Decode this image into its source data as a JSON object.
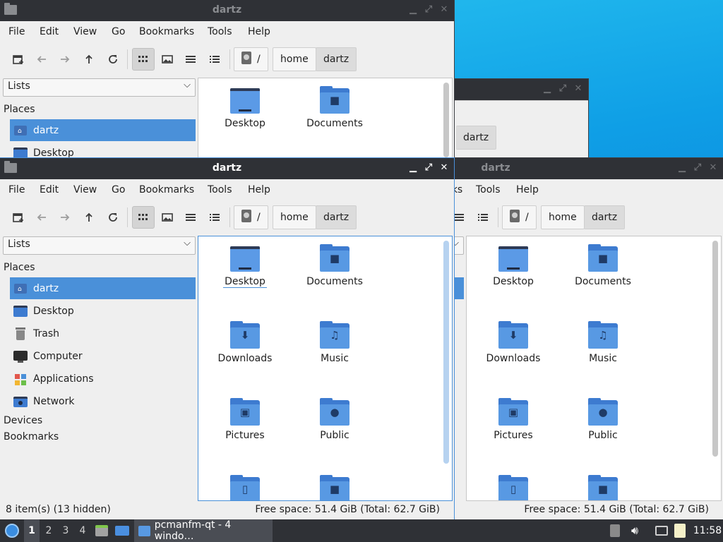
{
  "colors": {
    "accent": "#4a90d9",
    "folder": "#5899e3",
    "titlebar": "#2f3136",
    "window_bg": "#efefef"
  },
  "window": {
    "title": "dartz",
    "menu": [
      "File",
      "Edit",
      "View",
      "Go",
      "Bookmarks",
      "Tools",
      "Help"
    ],
    "toolbar": [
      "new-tab-icon",
      "back-arrow-icon",
      "forward-arrow-icon",
      "up-arrow-icon",
      "reload-icon",
      "icon-view-icon",
      "thumbnail-view-icon",
      "compact-view-icon",
      "detailed-list-icon"
    ],
    "path": {
      "root": "/",
      "segments": [
        "home",
        "dartz"
      ]
    },
    "side_mode": "Lists",
    "places_header": "Places",
    "places": [
      {
        "label": "dartz",
        "icon": "home-folder-icon"
      },
      {
        "label": "Desktop",
        "icon": "desktop-icon"
      },
      {
        "label": "Trash",
        "icon": "trash-icon"
      },
      {
        "label": "Computer",
        "icon": "computer-icon"
      },
      {
        "label": "Applications",
        "icon": "applications-icon"
      },
      {
        "label": "Network",
        "icon": "network-icon"
      }
    ],
    "devices_header": "Devices",
    "bookmarks_header": "Bookmarks",
    "files": [
      {
        "name": "Desktop",
        "icon": "desktop-folder-icon"
      },
      {
        "name": "Documents",
        "icon": "documents-folder-icon",
        "glyph": "■"
      },
      {
        "name": "Downloads",
        "icon": "downloads-folder-icon",
        "glyph": "⬇"
      },
      {
        "name": "Music",
        "icon": "music-folder-icon",
        "glyph": "♫"
      },
      {
        "name": "Pictures",
        "icon": "pictures-folder-icon",
        "glyph": "▣"
      },
      {
        "name": "Public",
        "icon": "public-folder-icon",
        "glyph": "●"
      },
      {
        "name": "",
        "icon": "templates-folder-icon",
        "glyph": "▯"
      },
      {
        "name": "",
        "icon": "videos-folder-icon",
        "glyph": "■"
      }
    ],
    "status_left": "8 item(s) (13 hidden)",
    "status_right": "Free space: 51.4 GiB (Total: 62.7 GiB)"
  },
  "bg_window": {
    "path_current": "dartz"
  },
  "taskbar": {
    "desktops": [
      "1",
      "2",
      "3",
      "4"
    ],
    "task_label": "pcmanfm-qt - 4 windo…",
    "clock": "11:58"
  }
}
